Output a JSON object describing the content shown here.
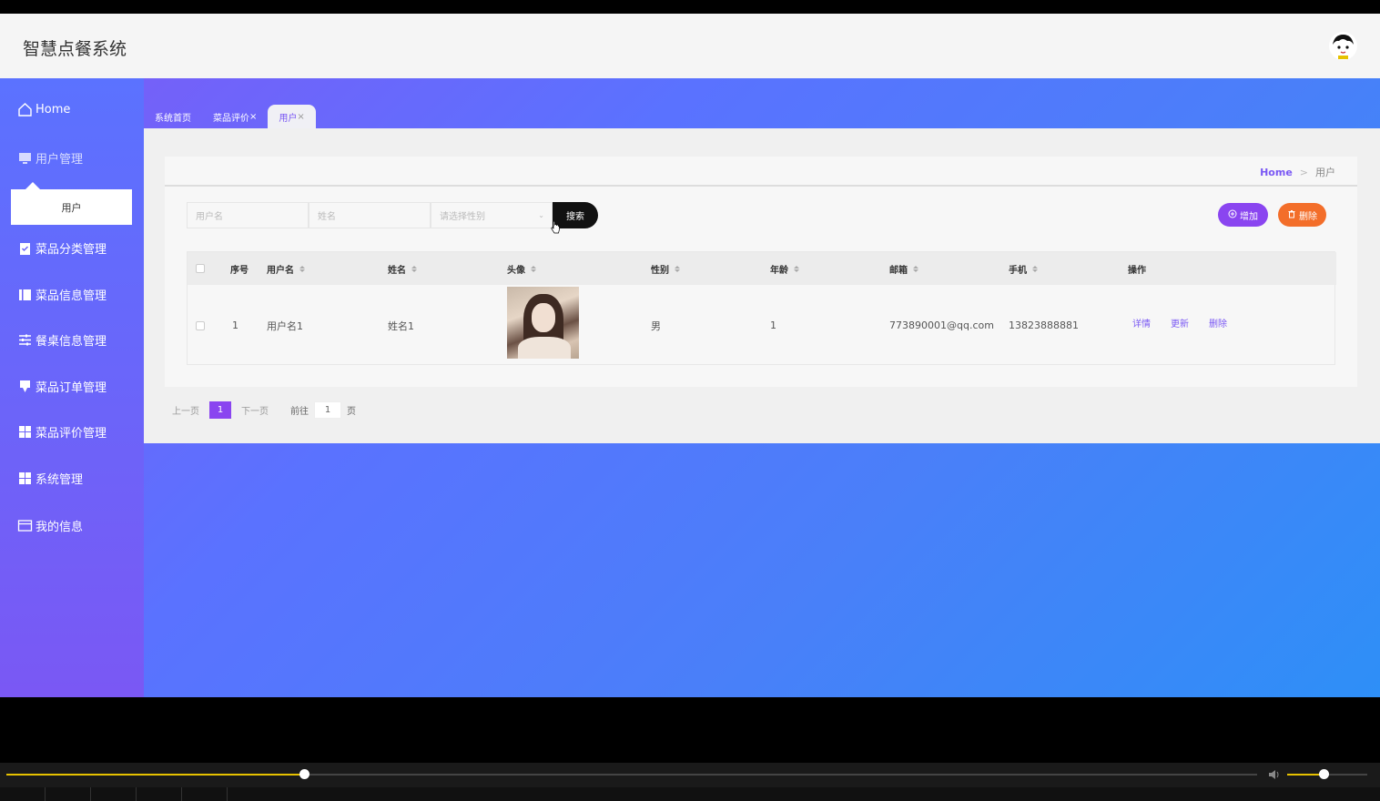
{
  "app": {
    "title": "智慧点餐系统"
  },
  "sidebar": {
    "items": [
      {
        "label": "Home",
        "icon": "home-icon"
      },
      {
        "label": "用户管理",
        "icon": "monitor-icon"
      },
      {
        "label": "菜品分类管理",
        "icon": "clipboard-icon"
      },
      {
        "label": "菜品信息管理",
        "icon": "book-icon"
      },
      {
        "label": "餐桌信息管理",
        "icon": "sliders-icon"
      },
      {
        "label": "菜品订单管理",
        "icon": "order-icon"
      },
      {
        "label": "菜品评价管理",
        "icon": "grid-icon"
      },
      {
        "label": "系统管理",
        "icon": "grid-icon"
      },
      {
        "label": "我的信息",
        "icon": "card-icon"
      }
    ],
    "submenu_user": "用户"
  },
  "tabs": [
    {
      "label": "系统首页"
    },
    {
      "label": "菜品评价",
      "closable": "×"
    },
    {
      "label": "用户",
      "closable": "×",
      "active": true
    }
  ],
  "breadcrumb": {
    "home": "Home",
    "separator": ">",
    "current": "用户"
  },
  "search": {
    "username_placeholder": "用户名",
    "name_placeholder": "姓名",
    "gender_placeholder": "请选择性别",
    "search_label": "搜索"
  },
  "actions": {
    "add_label": "增加",
    "delete_label": "删除"
  },
  "table": {
    "headers": [
      "序号",
      "用户名",
      "姓名",
      "头像",
      "性别",
      "年龄",
      "邮箱",
      "手机",
      "操作"
    ],
    "rows": [
      {
        "index": "1",
        "username": "用户名1",
        "name": "姓名1",
        "gender": "男",
        "age": "1",
        "email": "773890001@qq.com",
        "phone": "13823888881",
        "ops": [
          "详情",
          "更新",
          "删除"
        ]
      }
    ]
  },
  "pagination": {
    "prev": "上一页",
    "current": "1",
    "next": "下一页",
    "goto_label": "前往",
    "goto_value": "1",
    "page_suffix": "页"
  },
  "player": {
    "progress": 0.238,
    "volume": 0.45
  },
  "colors": {
    "accent": "#7a58f4",
    "add_button": "#8a45f0",
    "delete_button": "#f36e2a"
  }
}
